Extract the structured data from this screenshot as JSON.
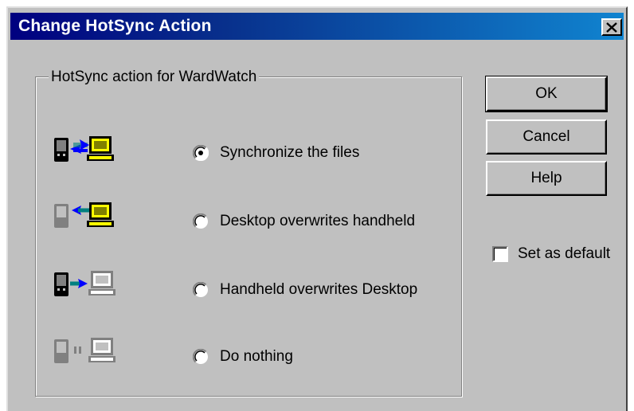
{
  "window": {
    "title": "Change HotSync Action",
    "close_glyph": "✕"
  },
  "group": {
    "legend": "HotSync action for WardWatch"
  },
  "options": [
    {
      "label": "Synchronize the files",
      "selected": true,
      "icon": "sync-both-icon"
    },
    {
      "label": "Desktop overwrites handheld",
      "selected": false,
      "icon": "desktop-to-handheld-icon"
    },
    {
      "label": "Handheld overwrites Desktop",
      "selected": false,
      "icon": "handheld-to-desktop-icon"
    },
    {
      "label": "Do nothing",
      "selected": false,
      "icon": "do-nothing-icon"
    }
  ],
  "buttons": {
    "ok_label": "OK",
    "cancel_label": "Cancel",
    "help_label": "Help"
  },
  "set_default": {
    "label": "Set as default",
    "checked": false
  },
  "colors": {
    "dialog_face": "#c0c0c0",
    "title_start": "#000080",
    "title_end": "#1084d0",
    "arrow_blue": "#0000ff",
    "arrow_teal": "#008080",
    "monitor_yellow": "#ffff00"
  }
}
